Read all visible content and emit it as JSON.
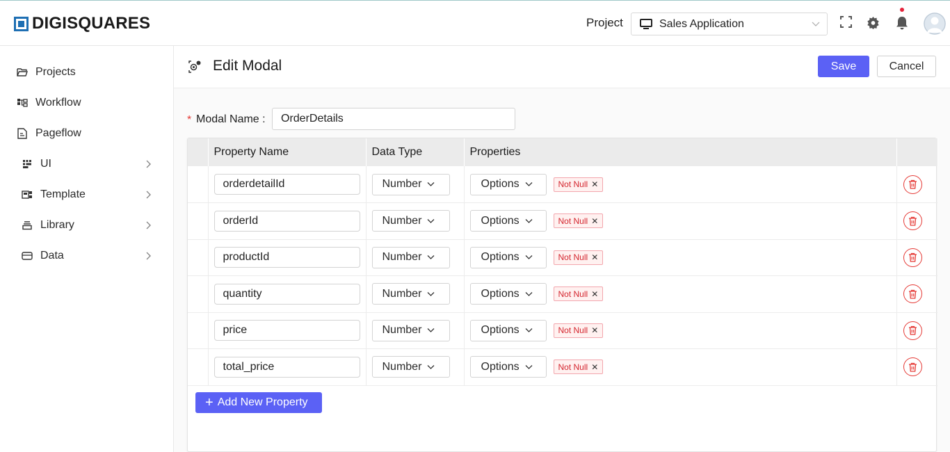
{
  "header": {
    "brand": "DIGISQUARES",
    "project_label": "Project",
    "project_value": "Sales Application"
  },
  "sidebar": {
    "items": [
      {
        "label": "Projects",
        "icon": "folder-icon"
      },
      {
        "label": "Workflow",
        "icon": "workflow-icon"
      },
      {
        "label": "Pageflow",
        "icon": "pageflow-icon"
      },
      {
        "label": "UI",
        "icon": "ui-grid-icon"
      },
      {
        "label": "Template",
        "icon": "template-icon"
      },
      {
        "label": "Library",
        "icon": "library-icon"
      },
      {
        "label": "Data",
        "icon": "data-icon"
      }
    ]
  },
  "page": {
    "title": "Edit Modal",
    "save_label": "Save",
    "cancel_label": "Cancel"
  },
  "form": {
    "required_mark": "*",
    "modal_name_label": "Modal Name :",
    "modal_name_value": "OrderDetails"
  },
  "table": {
    "headers": [
      "Property Name",
      "Data Type",
      "Properties"
    ],
    "rows": [
      {
        "name": "orderdetailId",
        "type": "Number",
        "options": "Options",
        "tag": "Not Null"
      },
      {
        "name": "orderId",
        "type": "Number",
        "options": "Options",
        "tag": "Not Null"
      },
      {
        "name": "productId",
        "type": "Number",
        "options": "Options",
        "tag": "Not Null"
      },
      {
        "name": "quantity",
        "type": "Number",
        "options": "Options",
        "tag": "Not Null"
      },
      {
        "name": "price",
        "type": "Number",
        "options": "Options",
        "tag": "Not Null"
      },
      {
        "name": "total_price",
        "type": "Number",
        "options": "Options",
        "tag": "Not Null"
      }
    ],
    "add_label": "Add New Property"
  },
  "colors": {
    "primary": "#5b61f5",
    "danger": "#e53935",
    "brand": "#1e6fb3"
  }
}
